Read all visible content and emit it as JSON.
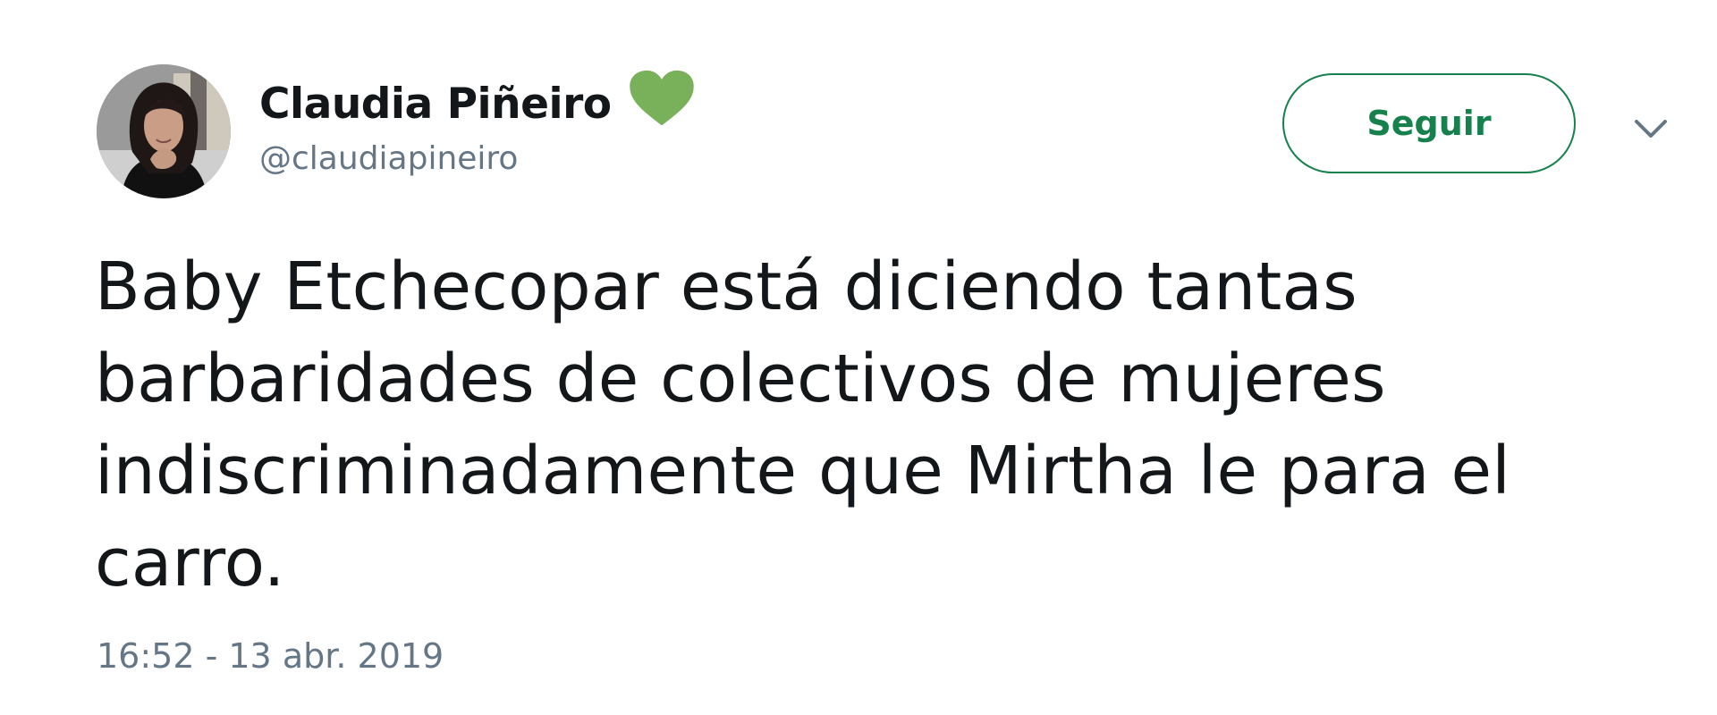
{
  "tweet": {
    "author": {
      "display_name": "Claudia Piñeiro",
      "handle": "@claudiapineiro",
      "badge_icon": "green-heart-icon",
      "badge_color": "#78b159"
    },
    "follow_label": "Seguir",
    "menu_icon": "chevron-down-icon",
    "text": "Baby Etchecopar está diciendo  tantas\nbarbaridades de colectivos de mujeres\nindiscriminadamente que Mirtha le para el\ncarro.",
    "timestamp": "16:52 - 13 abr. 2019"
  },
  "colors": {
    "accent": "#17814e",
    "text_primary": "#14171a",
    "text_secondary": "#657786",
    "caret": "#657786"
  }
}
